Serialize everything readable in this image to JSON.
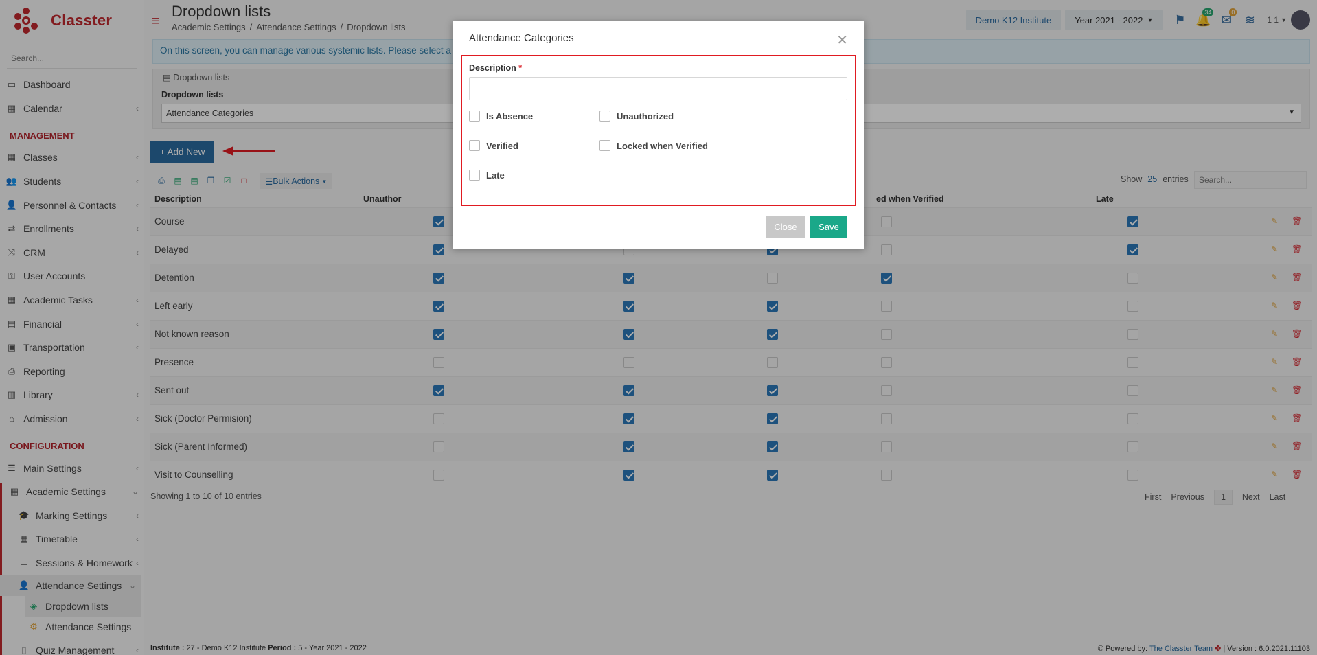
{
  "app": {
    "name": "Classter"
  },
  "sidebar": {
    "search_placeholder": "Search...",
    "items": [
      {
        "label": "Dashboard",
        "icon": "laptop-icon"
      },
      {
        "label": "Calendar",
        "icon": "calendar-icon"
      },
      {
        "label": "Classes",
        "icon": "grid-icon"
      },
      {
        "label": "Students",
        "icon": "users-icon"
      },
      {
        "label": "Personnel & Contacts",
        "icon": "user-icon"
      },
      {
        "label": "Enrollments",
        "icon": "exchange-icon"
      },
      {
        "label": "CRM",
        "icon": "shuffle-icon"
      },
      {
        "label": "User Accounts",
        "icon": "key-icon"
      },
      {
        "label": "Academic Tasks",
        "icon": "grid-icon"
      },
      {
        "label": "Financial",
        "icon": "money-icon"
      },
      {
        "label": "Transportation",
        "icon": "bus-icon"
      },
      {
        "label": "Reporting",
        "icon": "print-icon"
      },
      {
        "label": "Library",
        "icon": "books-icon"
      },
      {
        "label": "Admission",
        "icon": "bank-icon"
      },
      {
        "label": "Main Settings",
        "icon": "sliders-icon"
      },
      {
        "label": "Academic Settings",
        "icon": "grid-icon"
      },
      {
        "label": "Marking Settings",
        "icon": "graduation-cap-icon"
      },
      {
        "label": "Timetable",
        "icon": "calendar-icon"
      },
      {
        "label": "Sessions & Homework",
        "icon": "presentation-icon"
      },
      {
        "label": "Attendance Settings",
        "icon": "user-check-icon"
      },
      {
        "label": "Dropdown lists",
        "icon": "layers-icon"
      },
      {
        "label": "Attendance Settings",
        "icon": "gear-icon"
      },
      {
        "label": "Quiz Management",
        "icon": "book-icon"
      }
    ],
    "management_heading": "MANAGEMENT",
    "configuration_heading": "CONFIGURATION"
  },
  "header": {
    "title": "Dropdown lists",
    "breadcrumb": [
      "Academic Settings",
      "/",
      "Attendance Settings",
      "/",
      "Dropdown lists"
    ],
    "institute": "Demo K12 Institute",
    "year": "Year 2021 - 2022",
    "notif_count": "34",
    "mail_count": "0",
    "user_short": "1 1"
  },
  "info": {
    "text": "On this screen, you can manage various systemic lists. Please select a Typ"
  },
  "dropdown_panel": {
    "legend": "Dropdown lists",
    "label": "Dropdown lists",
    "selected": "Attendance Categories"
  },
  "toolbar": {
    "add_new": "+ Add New",
    "bulk_actions": "Bulk Actions",
    "show": "Show",
    "show_count": "25",
    "entries": "entries",
    "search_placeholder": "Search..."
  },
  "table": {
    "headers": [
      "Description",
      "Unauthor",
      "ed when Verified",
      "Late"
    ],
    "rows": [
      {
        "desc": "Course",
        "c": [
          true,
          false,
          false,
          false,
          true
        ]
      },
      {
        "desc": "Delayed",
        "c": [
          true,
          false,
          true,
          false,
          true
        ]
      },
      {
        "desc": "Detention",
        "c": [
          true,
          true,
          false,
          true,
          false
        ]
      },
      {
        "desc": "Left early",
        "c": [
          true,
          true,
          true,
          false,
          false
        ]
      },
      {
        "desc": "Not known reason",
        "c": [
          true,
          true,
          true,
          false,
          false
        ]
      },
      {
        "desc": "Presence",
        "c": [
          false,
          false,
          false,
          false,
          false
        ]
      },
      {
        "desc": "Sent out",
        "c": [
          true,
          true,
          true,
          false,
          false
        ]
      },
      {
        "desc": "Sick (Doctor Permision)",
        "c": [
          false,
          true,
          true,
          false,
          false
        ]
      },
      {
        "desc": "Sick (Parent Informed)",
        "c": [
          false,
          true,
          true,
          false,
          false
        ]
      },
      {
        "desc": "Visit to Counselling",
        "c": [
          false,
          true,
          true,
          false,
          false
        ]
      }
    ],
    "showing": "Showing 1 to 10 of 10 entries",
    "pager": {
      "first": "First",
      "previous": "Previous",
      "current": "1",
      "next": "Next",
      "last": "Last"
    }
  },
  "footer": {
    "institute_label": "Institute :",
    "institute_value": "27 - Demo K12 Institute",
    "period_label": "Period :",
    "period_value": "5 - Year 2021 - 2022",
    "powered": "Powered by:",
    "team": "The Classter Team",
    "version": "| Version : 6.0.2021.11103"
  },
  "modal": {
    "title": "Attendance Categories",
    "description_label": "Description",
    "required_mark": "*",
    "checkboxes": [
      "Is Absence",
      "Unauthorized",
      "Verified",
      "Locked when Verified",
      "Late"
    ],
    "close": "Close",
    "save": "Save"
  },
  "colors": {
    "brand": "#c0282e",
    "primary": "#2a6aa0",
    "success": "#1aa889",
    "highlight": "#e01b22"
  }
}
